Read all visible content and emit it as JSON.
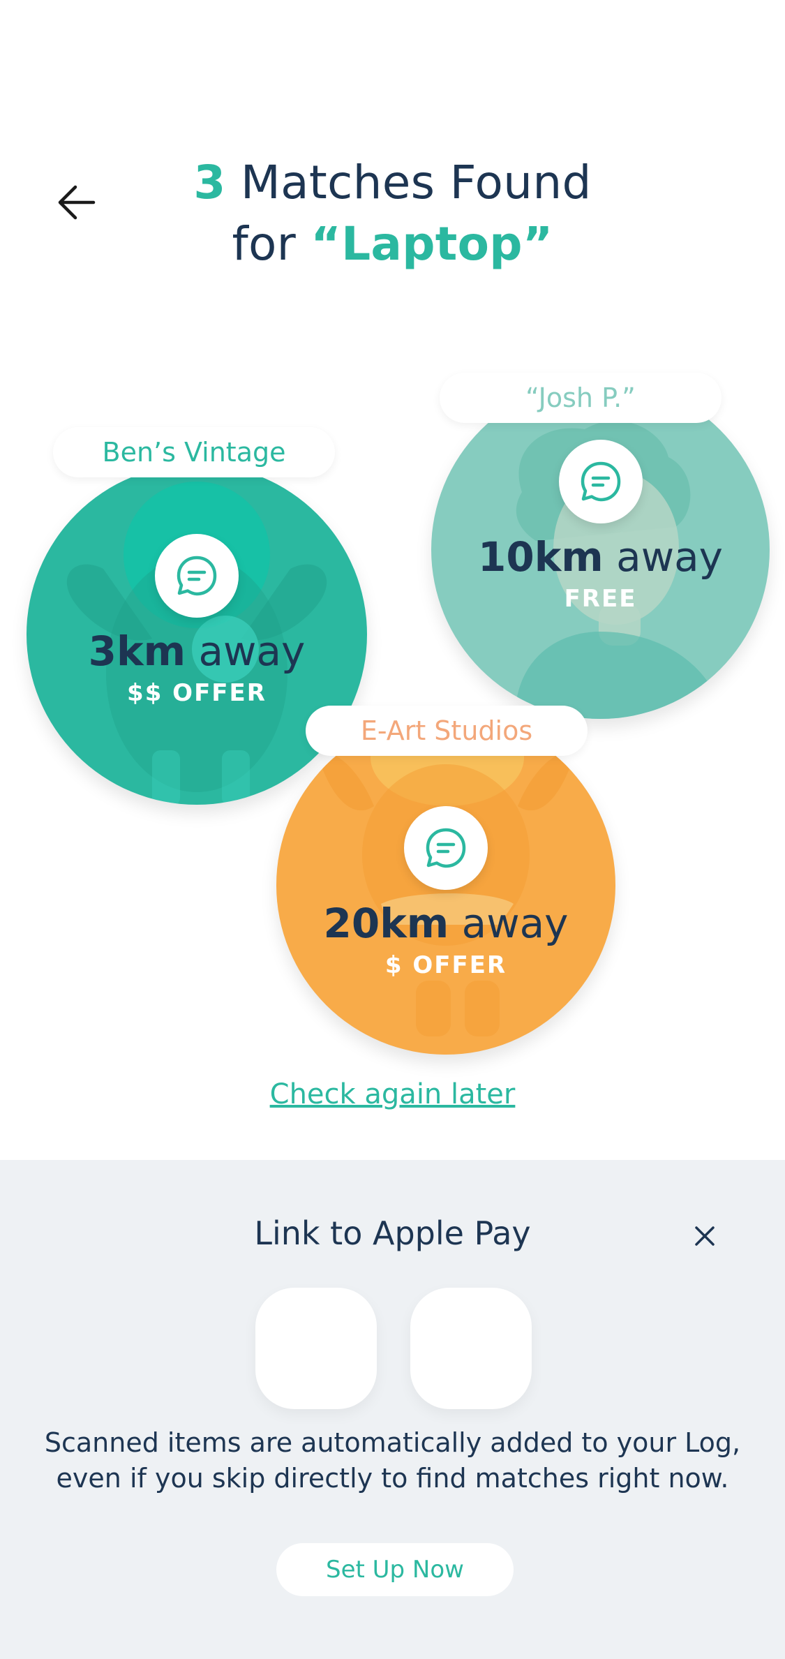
{
  "header": {
    "back_icon": "arrow-left-icon",
    "title": {
      "count": "3",
      "line1_rest": " Matches Found",
      "line2_prefix": "for ",
      "query": "“Laptop”"
    }
  },
  "matches": [
    {
      "seller": "Ben’s Vintage",
      "distance_value": "3km",
      "distance_suffix": " away",
      "offer": "$$ OFFER",
      "icon": "chat-bubble-icon",
      "color": "#2bb8a0",
      "label_color": "#2bb8a0"
    },
    {
      "seller": "“Josh P.”",
      "distance_value": "10km",
      "distance_suffix": " away",
      "offer": "FREE",
      "icon": "chat-bubble-icon",
      "color": "#86ccbf",
      "label_color": "#86ccbf"
    },
    {
      "seller": "E-Art Studios",
      "distance_value": "20km",
      "distance_suffix": " away",
      "offer": "$ OFFER",
      "icon": "chat-bubble-icon",
      "color": "#f8ab49",
      "label_color": "#f3a77a"
    }
  ],
  "check_again": "Check again later",
  "apple_pay": {
    "title": "Link to Apple Pay",
    "close_icon": "close-icon",
    "description": "Scanned items are automatically added to your Log, even if you skip directly to find matches right now.",
    "setup_button": "Set Up Now"
  },
  "colors": {
    "accent": "#2bb8a0",
    "text_dark": "#1d3552",
    "sheet_bg": "#eef1f4"
  }
}
